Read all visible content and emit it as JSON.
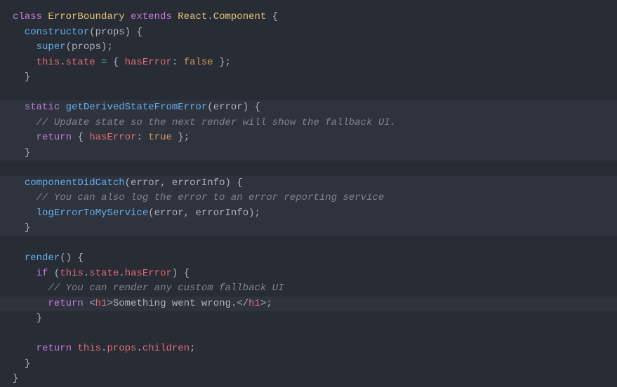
{
  "code": {
    "lines": [
      {
        "indent": 0,
        "hl": false,
        "tokens": [
          {
            "cls": "tok-kw",
            "t": "class"
          },
          {
            "cls": "",
            "t": " "
          },
          {
            "cls": "tok-cls",
            "t": "ErrorBoundary"
          },
          {
            "cls": "",
            "t": " "
          },
          {
            "cls": "tok-kw",
            "t": "extends"
          },
          {
            "cls": "",
            "t": " "
          },
          {
            "cls": "tok-cls",
            "t": "React"
          },
          {
            "cls": "tok-punct",
            "t": "."
          },
          {
            "cls": "tok-cls",
            "t": "Component"
          },
          {
            "cls": "",
            "t": " "
          },
          {
            "cls": "tok-punct",
            "t": "{"
          }
        ]
      },
      {
        "indent": 1,
        "hl": false,
        "tokens": [
          {
            "cls": "tok-fn",
            "t": "constructor"
          },
          {
            "cls": "tok-punct",
            "t": "("
          },
          {
            "cls": "tok-param",
            "t": "props"
          },
          {
            "cls": "tok-punct",
            "t": ")"
          },
          {
            "cls": "",
            "t": " "
          },
          {
            "cls": "tok-punct",
            "t": "{"
          }
        ]
      },
      {
        "indent": 2,
        "hl": false,
        "tokens": [
          {
            "cls": "tok-fn",
            "t": "super"
          },
          {
            "cls": "tok-punct",
            "t": "("
          },
          {
            "cls": "tok-param",
            "t": "props"
          },
          {
            "cls": "tok-punct",
            "t": ");"
          }
        ]
      },
      {
        "indent": 2,
        "hl": false,
        "tokens": [
          {
            "cls": "tok-this",
            "t": "this"
          },
          {
            "cls": "tok-punct",
            "t": "."
          },
          {
            "cls": "tok-prop",
            "t": "state"
          },
          {
            "cls": "",
            "t": " "
          },
          {
            "cls": "tok-op",
            "t": "="
          },
          {
            "cls": "",
            "t": " "
          },
          {
            "cls": "tok-punct",
            "t": "{"
          },
          {
            "cls": "",
            "t": " "
          },
          {
            "cls": "tok-prop",
            "t": "hasError"
          },
          {
            "cls": "tok-punct",
            "t": ":"
          },
          {
            "cls": "",
            "t": " "
          },
          {
            "cls": "tok-bool",
            "t": "false"
          },
          {
            "cls": "",
            "t": " "
          },
          {
            "cls": "tok-punct",
            "t": "};"
          }
        ]
      },
      {
        "indent": 1,
        "hl": false,
        "tokens": [
          {
            "cls": "tok-punct",
            "t": "}"
          }
        ]
      },
      {
        "indent": 0,
        "hl": false,
        "tokens": []
      },
      {
        "indent": 1,
        "hl": true,
        "tokens": [
          {
            "cls": "tok-kw",
            "t": "static"
          },
          {
            "cls": "",
            "t": " "
          },
          {
            "cls": "tok-fn",
            "t": "getDerivedStateFromError"
          },
          {
            "cls": "tok-punct",
            "t": "("
          },
          {
            "cls": "tok-param",
            "t": "error"
          },
          {
            "cls": "tok-punct",
            "t": ")"
          },
          {
            "cls": "",
            "t": " "
          },
          {
            "cls": "tok-punct",
            "t": "{"
          }
        ]
      },
      {
        "indent": 2,
        "hl": true,
        "tokens": [
          {
            "cls": "tok-comment",
            "t": "// Update state so the next render will show the fallback UI."
          }
        ]
      },
      {
        "indent": 2,
        "hl": true,
        "tokens": [
          {
            "cls": "tok-kw",
            "t": "return"
          },
          {
            "cls": "",
            "t": " "
          },
          {
            "cls": "tok-punct",
            "t": "{"
          },
          {
            "cls": "",
            "t": " "
          },
          {
            "cls": "tok-prop",
            "t": "hasError"
          },
          {
            "cls": "tok-punct",
            "t": ":"
          },
          {
            "cls": "",
            "t": " "
          },
          {
            "cls": "tok-bool",
            "t": "true"
          },
          {
            "cls": "",
            "t": " "
          },
          {
            "cls": "tok-punct",
            "t": "};"
          }
        ]
      },
      {
        "indent": 1,
        "hl": true,
        "tokens": [
          {
            "cls": "tok-punct",
            "t": "}"
          }
        ]
      },
      {
        "indent": 0,
        "hl": false,
        "tokens": []
      },
      {
        "indent": 1,
        "hl": true,
        "tokens": [
          {
            "cls": "tok-fn",
            "t": "componentDidCatch"
          },
          {
            "cls": "tok-punct",
            "t": "("
          },
          {
            "cls": "tok-param",
            "t": "error"
          },
          {
            "cls": "tok-punct",
            "t": ","
          },
          {
            "cls": "",
            "t": " "
          },
          {
            "cls": "tok-param",
            "t": "errorInfo"
          },
          {
            "cls": "tok-punct",
            "t": ")"
          },
          {
            "cls": "",
            "t": " "
          },
          {
            "cls": "tok-punct",
            "t": "{"
          }
        ]
      },
      {
        "indent": 2,
        "hl": true,
        "tokens": [
          {
            "cls": "tok-comment",
            "t": "// You can also log the error to an error reporting service"
          }
        ]
      },
      {
        "indent": 2,
        "hl": true,
        "tokens": [
          {
            "cls": "tok-fn",
            "t": "logErrorToMyService"
          },
          {
            "cls": "tok-punct",
            "t": "("
          },
          {
            "cls": "tok-param",
            "t": "error"
          },
          {
            "cls": "tok-punct",
            "t": ","
          },
          {
            "cls": "",
            "t": " "
          },
          {
            "cls": "tok-param",
            "t": "errorInfo"
          },
          {
            "cls": "tok-punct",
            "t": ");"
          }
        ]
      },
      {
        "indent": 1,
        "hl": true,
        "tokens": [
          {
            "cls": "tok-punct",
            "t": "}"
          }
        ]
      },
      {
        "indent": 0,
        "hl": false,
        "tokens": []
      },
      {
        "indent": 1,
        "hl": false,
        "tokens": [
          {
            "cls": "tok-fn",
            "t": "render"
          },
          {
            "cls": "tok-punct",
            "t": "()"
          },
          {
            "cls": "",
            "t": " "
          },
          {
            "cls": "tok-punct",
            "t": "{"
          }
        ]
      },
      {
        "indent": 2,
        "hl": false,
        "tokens": [
          {
            "cls": "tok-kw",
            "t": "if"
          },
          {
            "cls": "",
            "t": " "
          },
          {
            "cls": "tok-punct",
            "t": "("
          },
          {
            "cls": "tok-this",
            "t": "this"
          },
          {
            "cls": "tok-punct",
            "t": "."
          },
          {
            "cls": "tok-prop",
            "t": "state"
          },
          {
            "cls": "tok-punct",
            "t": "."
          },
          {
            "cls": "tok-prop",
            "t": "hasError"
          },
          {
            "cls": "tok-punct",
            "t": ")"
          },
          {
            "cls": "",
            "t": " "
          },
          {
            "cls": "tok-punct",
            "t": "{"
          }
        ]
      },
      {
        "indent": 3,
        "hl": false,
        "tokens": [
          {
            "cls": "tok-comment",
            "t": "// You can render any custom fallback UI"
          }
        ]
      },
      {
        "indent": 3,
        "hl": true,
        "tokens": [
          {
            "cls": "tok-kw",
            "t": "return"
          },
          {
            "cls": "",
            "t": " "
          },
          {
            "cls": "tok-punct",
            "t": "<"
          },
          {
            "cls": "tok-tag",
            "t": "h1"
          },
          {
            "cls": "tok-punct",
            "t": ">"
          },
          {
            "cls": "tok-str",
            "t": "Something went wrong."
          },
          {
            "cls": "tok-punct",
            "t": "</"
          },
          {
            "cls": "tok-tag",
            "t": "h1"
          },
          {
            "cls": "tok-punct",
            "t": ">;"
          }
        ]
      },
      {
        "indent": 2,
        "hl": false,
        "tokens": [
          {
            "cls": "tok-punct",
            "t": "}"
          }
        ]
      },
      {
        "indent": 0,
        "hl": false,
        "tokens": []
      },
      {
        "indent": 2,
        "hl": false,
        "tokens": [
          {
            "cls": "tok-kw",
            "t": "return"
          },
          {
            "cls": "",
            "t": " "
          },
          {
            "cls": "tok-this",
            "t": "this"
          },
          {
            "cls": "tok-punct",
            "t": "."
          },
          {
            "cls": "tok-prop",
            "t": "props"
          },
          {
            "cls": "tok-punct",
            "t": "."
          },
          {
            "cls": "tok-prop",
            "t": "children"
          },
          {
            "cls": "tok-punct",
            "t": ";"
          }
        ]
      },
      {
        "indent": 1,
        "hl": false,
        "tokens": [
          {
            "cls": "tok-punct",
            "t": "}"
          }
        ]
      },
      {
        "indent": 0,
        "hl": false,
        "tokens": [
          {
            "cls": "tok-punct",
            "t": "}"
          }
        ]
      }
    ]
  }
}
